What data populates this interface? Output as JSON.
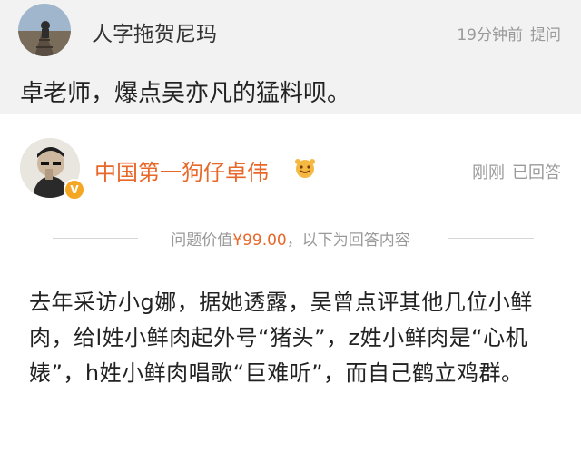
{
  "question": {
    "author": "人字拖贺尼玛",
    "time": "19分钟前",
    "action": "提问",
    "text": "卓老师，爆点吴亦凡的猛料呗。"
  },
  "answer": {
    "author": "中国第一狗仔卓伟",
    "time": "刚刚",
    "status": "已回答",
    "price_prefix": "问题价值",
    "price": "¥99.00",
    "price_suffix": "，以下为回答内容",
    "text": "去年采访小g娜，据她透露，吴曾点评其他几位小鲜肉，给l姓小鲜肉起外号“猪头”，z姓小鲜肉是“心机婊”，h姓小鲜肉唱歌“巨难听”，而自己鹤立鸡群。"
  },
  "colors": {
    "accent": "#e8682a",
    "question_bg": "#f2f2f2",
    "meta_gray": "#9a9a9a",
    "verified_badge": "#f5a623"
  },
  "icons": [
    "avatar-railway-photo",
    "avatar-man-photo",
    "verified-v-icon",
    "emoji-icon"
  ]
}
